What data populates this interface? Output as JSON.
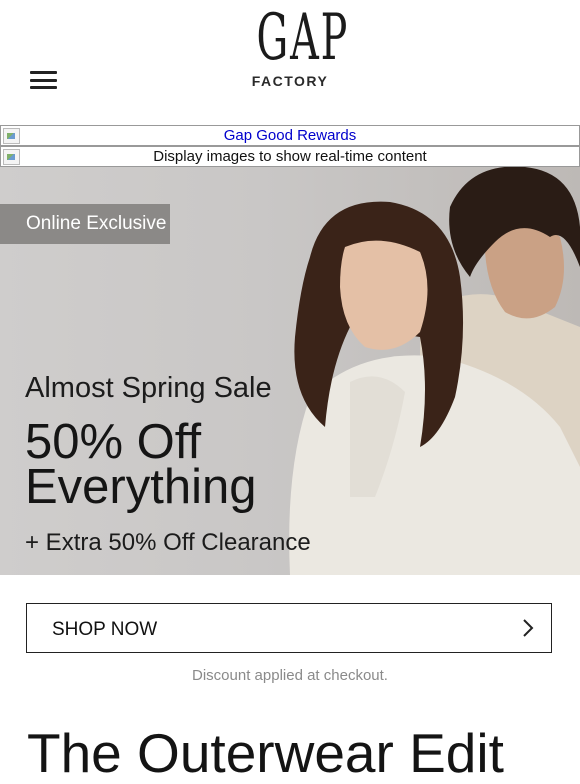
{
  "header": {
    "logo_text": "GAP",
    "logo_sub": "FACTORY",
    "menu_icon": "hamburger-menu-icon"
  },
  "image_rows": {
    "rewards_link": "Gap Good Rewards",
    "display_images_text": "Display images to show real-time content"
  },
  "hero": {
    "badge": "Online Exclusive",
    "subtitle": "Almost Spring Sale",
    "headline_line1": "50% Off",
    "headline_line2": "Everything",
    "extra": "+ Extra 50% Off Clearance"
  },
  "cta": {
    "label": "SHOP NOW",
    "icon": "chevron-right-icon"
  },
  "note": "Discount applied at checkout.",
  "section": {
    "title": "The Outerwear Edit"
  },
  "colors": {
    "badge_bg": "#8b8987",
    "link": "#0000cc",
    "note_text": "#8a8a8a"
  }
}
